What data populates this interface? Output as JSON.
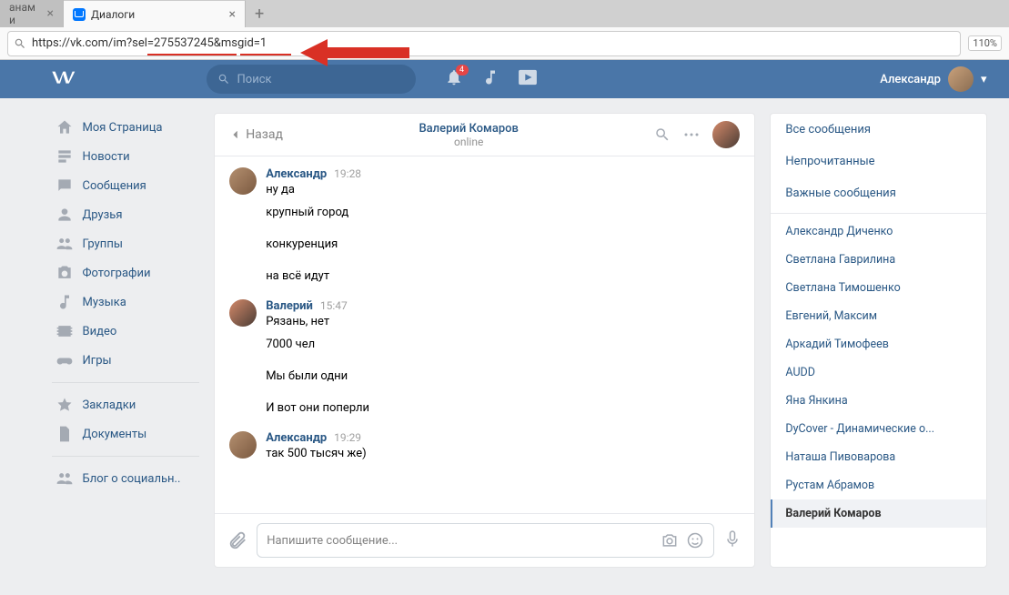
{
  "browser": {
    "tab_inactive_label": "анам и",
    "tab_active_label": "Диалоги",
    "url": "https://vk.com/im?sel=275537245&msgid=1",
    "zoom": "110%"
  },
  "header": {
    "search_placeholder": "Поиск",
    "notif_count": "4",
    "username": "Александр"
  },
  "left_nav": {
    "my_page": "Моя Страница",
    "news": "Новости",
    "messages": "Сообщения",
    "friends": "Друзья",
    "groups": "Группы",
    "photos": "Фотографии",
    "music": "Музыка",
    "video": "Видео",
    "games": "Игры",
    "bookmarks": "Закладки",
    "documents": "Документы",
    "blog": "Блог о социальн.."
  },
  "dialog": {
    "back": "Назад",
    "contact_name": "Валерий Комаров",
    "status": "online",
    "compose_placeholder": "Напишите сообщение..."
  },
  "messages": [
    {
      "author": "Александр",
      "time": "19:28",
      "first_line": "ну да",
      "lines": [
        "крупный город",
        "конкуренция",
        "на всё идут"
      ],
      "avatar": "alex"
    },
    {
      "author": "Валерий",
      "time": "15:47",
      "first_line": "Рязань, нет",
      "lines": [
        "7000 чел",
        "Мы были одни",
        "И вот они поперли"
      ],
      "avatar": "couple"
    },
    {
      "author": "Александр",
      "time": "19:29",
      "first_line": "так 500 тысяч же)",
      "lines": [],
      "avatar": "alex"
    }
  ],
  "right": {
    "filters": [
      "Все сообщения",
      "Непрочитанные",
      "Важные сообщения"
    ],
    "contacts": [
      "Александр Диченко",
      "Светлана Гаврилина",
      "Светлана Тимошенко",
      "Евгений, Максим",
      "Аркадий Тимофеев",
      "AUDD",
      "Яна Янкина",
      "DyCover - Динамические о...",
      "Наташа Пивоварова",
      "Рустам Абрамов",
      "Валерий Комаров"
    ],
    "active_contact": "Валерий Комаров"
  }
}
